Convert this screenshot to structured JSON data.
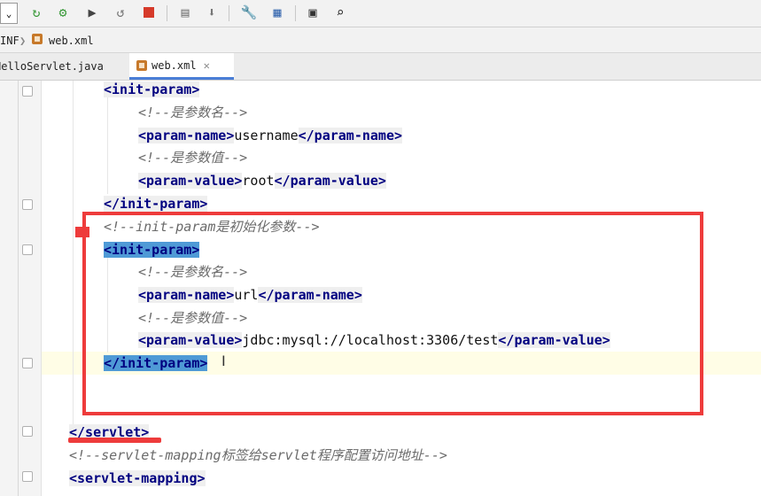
{
  "breadcrumb": {
    "folder": "INF",
    "file": "web.xml"
  },
  "tabs": [
    {
      "label": "HelloServlet.java"
    },
    {
      "label": "web.xml",
      "close": "✕"
    }
  ],
  "code": {
    "l1": {
      "open": "<init-param>"
    },
    "l2": {
      "comment": "<!--是参数名-->"
    },
    "l3": {
      "open": "<param-name>",
      "text": "username",
      "close": "</param-name>"
    },
    "l4": {
      "comment": "<!--是参数值-->"
    },
    "l5": {
      "open": "<param-value>",
      "text": "root",
      "close": "</param-value>"
    },
    "l6": {
      "close": "</init-param>"
    },
    "l7": {
      "comment": "<!--init-param是初始化参数-->"
    },
    "l8": {
      "open": "<init-param>"
    },
    "l9": {
      "comment": "<!--是参数名-->"
    },
    "l10": {
      "open": "<param-name>",
      "text": "url",
      "close": "</param-name>"
    },
    "l11": {
      "comment": "<!--是参数值-->"
    },
    "l12": {
      "open": "<param-value>",
      "text": "jdbc:mysql://localhost:3306/test",
      "close": "</param-value>"
    },
    "l13": {
      "close": "</init-param>"
    },
    "l15": {
      "close": "</servlet>"
    },
    "l16": {
      "comment": "<!--servlet-mapping标签给servlet程序配置访问地址-->"
    },
    "l17": {
      "open": "<servlet-mapping>"
    }
  },
  "colors": {
    "tag": "#000080",
    "comment": "#6b6b6b",
    "selection": "#4f9ad6",
    "annotation_red": "#ee3b3b"
  }
}
